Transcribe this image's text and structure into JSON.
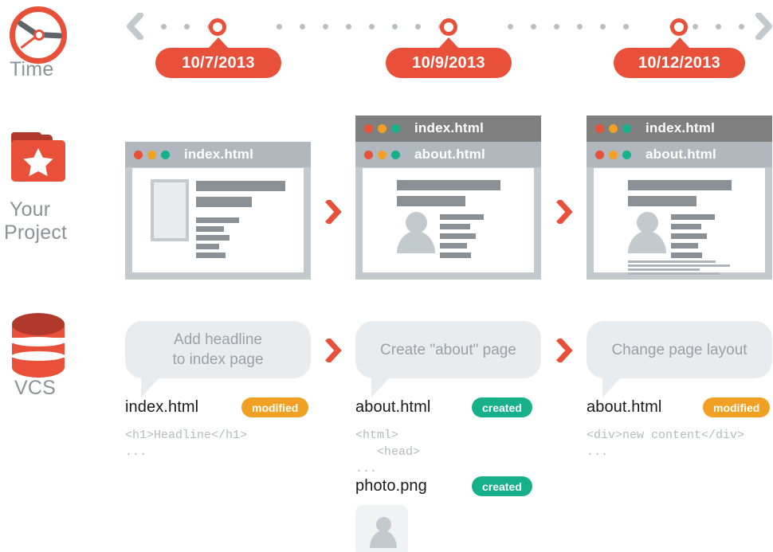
{
  "rows": {
    "time": {
      "label": "Time",
      "icon": "clock-icon"
    },
    "project": {
      "label_line1": "Your",
      "label_line2": "Project",
      "icon": "folder-star-icon"
    },
    "vcs": {
      "label": "VCS",
      "icon": "database-icon"
    }
  },
  "timeline": {
    "prev_arrow": "chevron-left-icon",
    "next_arrow": "chevron-right-icon",
    "dates": [
      "10/7/2013",
      "10/9/2013",
      "10/12/2013"
    ]
  },
  "columns": [
    {
      "windows": [
        {
          "title": "index.html",
          "layer": "front"
        }
      ],
      "commit_message": "Add headline\nto index page",
      "files": [
        {
          "name": "index.html",
          "status": "modified",
          "status_color": "#f0a023",
          "code": "<h1>Headline</h1>\n..."
        }
      ]
    },
    {
      "windows": [
        {
          "title": "index.html",
          "layer": "back"
        },
        {
          "title": "about.html",
          "layer": "front"
        }
      ],
      "commit_message": "Create \"about\" page",
      "files": [
        {
          "name": "about.html",
          "status": "created",
          "status_color": "#17b08a",
          "code": "<html>\n   <head>\n..."
        },
        {
          "name": "photo.png",
          "status": "created",
          "status_color": "#17b08a",
          "thumbnail": "person-thumbnail-icon"
        }
      ]
    },
    {
      "windows": [
        {
          "title": "index.html",
          "layer": "back"
        },
        {
          "title": "about.html",
          "layer": "front"
        }
      ],
      "commit_message": "Change page layout",
      "files": [
        {
          "name": "about.html",
          "status": "modified",
          "status_color": "#f0a023",
          "code": "<div>new content</div>\n..."
        }
      ]
    }
  ],
  "separators": [
    "chevron-right-icon",
    "chevron-right-icon"
  ],
  "colors": {
    "accent_red": "#e8503a",
    "dark_red": "#b0392b",
    "label_gray": "#8c9296",
    "bubble_gray": "#e9ecef",
    "orange": "#f0a023",
    "green": "#17b08a",
    "window_bar_dark": "#808080",
    "window_bar_light": "#b0b8bd"
  }
}
